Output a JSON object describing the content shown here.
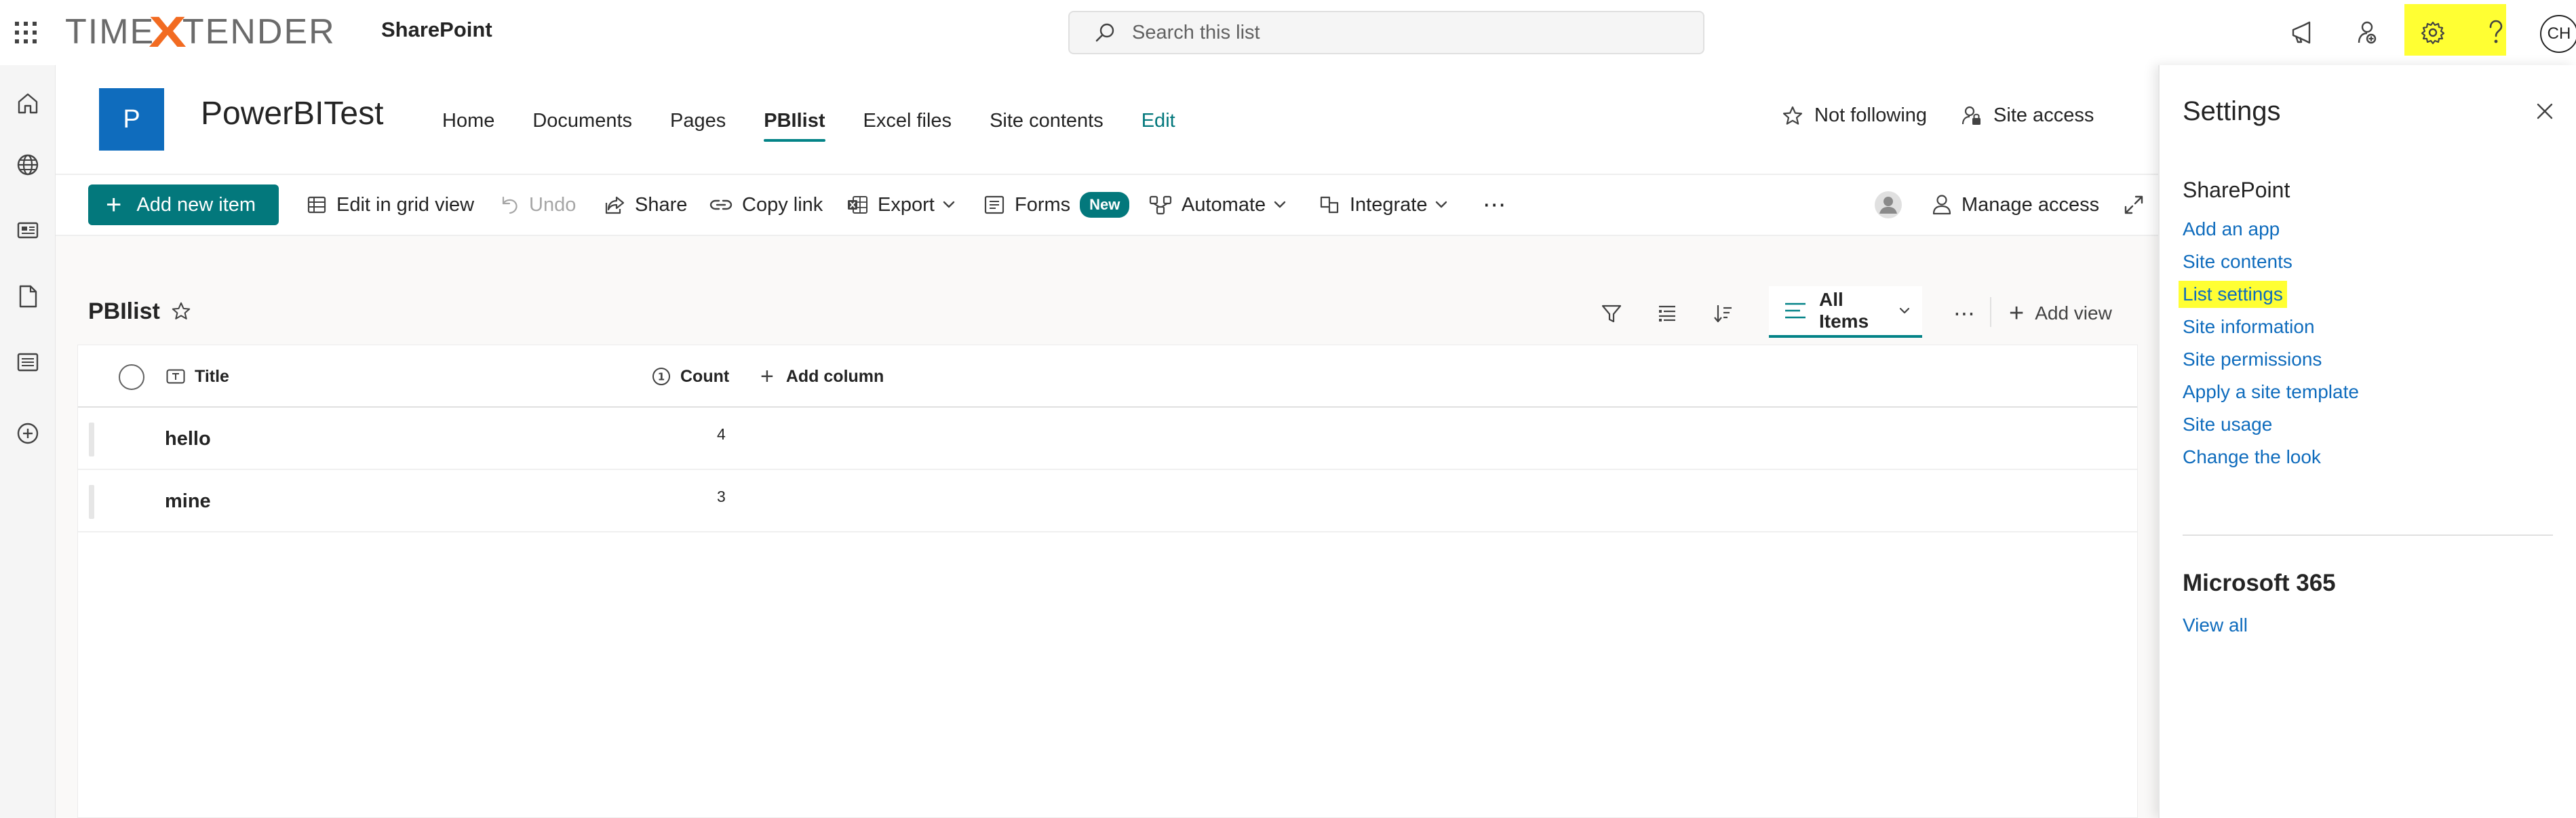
{
  "header": {
    "brand": {
      "left": "TIME",
      "x": "X",
      "right": "TENDER"
    },
    "app_name": "SharePoint",
    "search_placeholder": "Search this list",
    "avatar_initials": "CH",
    "icons": [
      "waffle-icon",
      "megaphone-icon",
      "share-feedback-icon",
      "gear-icon",
      "help-icon"
    ]
  },
  "site": {
    "logo_letter": "P",
    "title": "PowerBITest",
    "nav": [
      "Home",
      "Documents",
      "Pages",
      "PBIlist",
      "Excel files",
      "Site contents",
      "Edit"
    ],
    "active_nav": "PBIlist",
    "actions": {
      "follow": "Not following",
      "site_access": "Site access"
    }
  },
  "command_bar": {
    "new_item": "Add new item",
    "grid_view": "Edit in grid view",
    "undo": "Undo",
    "share": "Share",
    "copy_link": "Copy link",
    "export": "Export",
    "forms": "Forms",
    "forms_badge": "New",
    "automate": "Automate",
    "integrate": "Integrate",
    "more": "⋯",
    "manage_access": "Manage access"
  },
  "list": {
    "title": "PBIlist",
    "view_name": "All Items",
    "more": "⋯",
    "add_view": "Add view",
    "columns": {
      "title": "Title",
      "count": "Count",
      "add": "Add column"
    },
    "rows": [
      {
        "title": "hello",
        "count": "4"
      },
      {
        "title": "mine",
        "count": "3"
      }
    ]
  },
  "settings": {
    "title": "Settings",
    "sharepoint_heading": "SharePoint",
    "links": [
      "Add an app",
      "Site contents",
      "List settings",
      "Site information",
      "Site permissions",
      "Apply a site template",
      "Site usage",
      "Change the look"
    ],
    "highlighted_link": "List settings",
    "m365_heading": "Microsoft 365",
    "m365_link": "View all"
  },
  "colors": {
    "accent": "#03787c",
    "site_logo": "#0f6cbd",
    "link": "#0f6cbd",
    "highlight": "#ffff33",
    "brand_x": "#f26b21"
  }
}
